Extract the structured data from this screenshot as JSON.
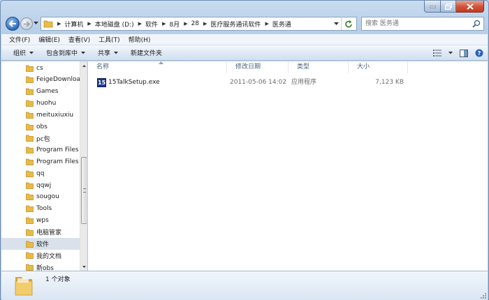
{
  "address": {
    "crumbs": [
      "计算机",
      "本地磁盘 (D:)",
      "软件",
      "8月",
      "28",
      "医疗服务通讯软件",
      "医务通"
    ]
  },
  "search": {
    "placeholder": "搜索 医务通"
  },
  "menu": {
    "file": "文件(F)",
    "edit": "编辑(E)",
    "view": "查看(V)",
    "tools": "工具(T)",
    "help": "帮助(H)"
  },
  "toolbar": {
    "organize": "组织",
    "include_library": "包含到库中",
    "share": "共享",
    "new_folder": "新建文件夹"
  },
  "nav_tree": [
    {
      "label": "cs"
    },
    {
      "label": "FeigeDownloa"
    },
    {
      "label": "Games"
    },
    {
      "label": "huohu"
    },
    {
      "label": "meituxiuxiu"
    },
    {
      "label": "obs"
    },
    {
      "label": "pc包"
    },
    {
      "label": "Program Files"
    },
    {
      "label": "Program Files"
    },
    {
      "label": "qq"
    },
    {
      "label": "qqwj"
    },
    {
      "label": "sougou"
    },
    {
      "label": "Tools"
    },
    {
      "label": "wps"
    },
    {
      "label": "电脑管家"
    },
    {
      "label": "软件",
      "selected": true
    },
    {
      "label": "我的文档"
    },
    {
      "label": "新obs"
    }
  ],
  "columns": {
    "name": "名称",
    "modified": "修改日期",
    "type": "类型",
    "size": "大小"
  },
  "files": [
    {
      "icon": "15",
      "name": "15TalkSetup.exe",
      "modified": "2011-05-06 14:02",
      "type": "应用程序",
      "size": "7,123 KB"
    }
  ],
  "status": {
    "count": "1 个对象"
  },
  "colors": {
    "selection": "#d9e1ea",
    "frame": "#b7cfe8",
    "header_text": "#4c607a"
  }
}
